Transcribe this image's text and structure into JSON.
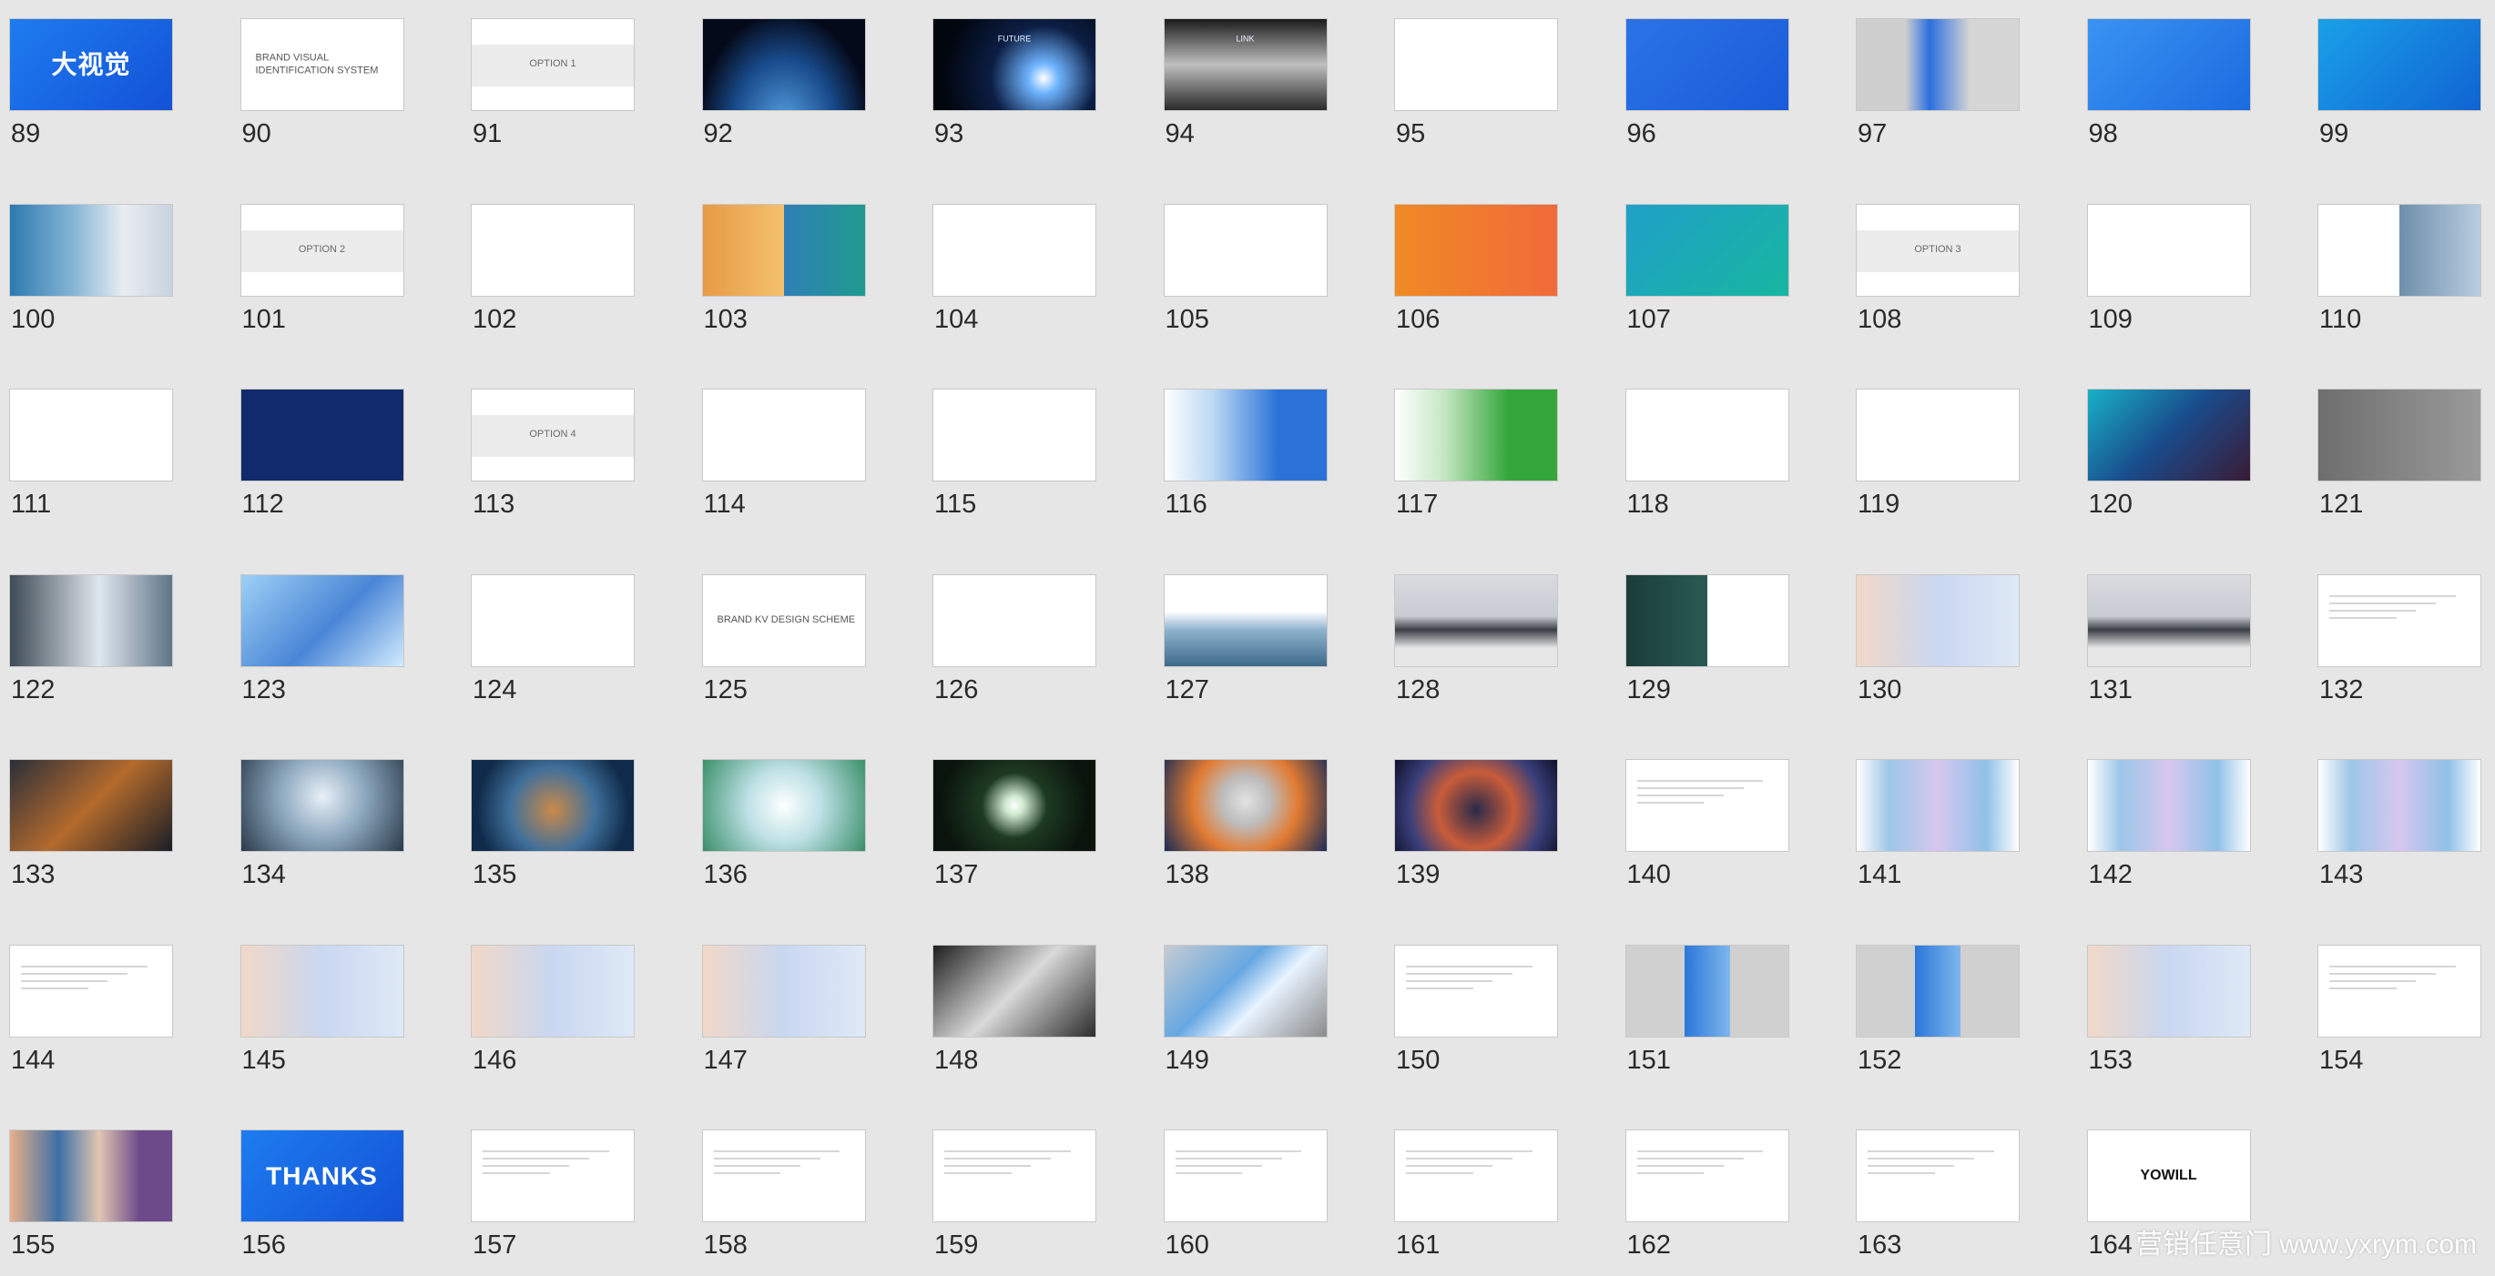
{
  "watermark": "营销任意门 www.yxrym.com",
  "colors": {
    "background": "#e6e6e6",
    "thumb_border": "#c8c8c8",
    "number_text": "#2a2a2a"
  },
  "slides": [
    {
      "number": "89",
      "text": "大视觉",
      "style": "blue-title"
    },
    {
      "number": "90",
      "text": "BRAND VISUAL IDENTIFICATION SYSTEM",
      "style": "white-left"
    },
    {
      "number": "91",
      "text": "OPTION 1",
      "style": "option"
    },
    {
      "number": "92",
      "text": "",
      "style": "earth"
    },
    {
      "number": "93",
      "text": "FUTURE",
      "style": "space-flare"
    },
    {
      "number": "94",
      "text": "LINK",
      "style": "train"
    },
    {
      "number": "95",
      "text": "",
      "style": "white"
    },
    {
      "number": "96",
      "text": "",
      "style": "blue"
    },
    {
      "number": "97",
      "text": "",
      "style": "gray-blue"
    },
    {
      "number": "98",
      "text": "",
      "style": "blue-cards"
    },
    {
      "number": "99",
      "text": "",
      "style": "blue-book"
    },
    {
      "number": "100",
      "text": "",
      "style": "books"
    },
    {
      "number": "101",
      "text": "OPTION 2",
      "style": "option"
    },
    {
      "number": "102",
      "text": "",
      "style": "white-logo"
    },
    {
      "number": "103",
      "text": "",
      "style": "sunset-split"
    },
    {
      "number": "104",
      "text": "",
      "style": "white-wave"
    },
    {
      "number": "105",
      "text": "",
      "style": "white-circles"
    },
    {
      "number": "106",
      "text": "",
      "style": "orange"
    },
    {
      "number": "107",
      "text": "",
      "style": "teal"
    },
    {
      "number": "108",
      "text": "OPTION 3",
      "style": "option"
    },
    {
      "number": "109",
      "text": "",
      "style": "white-logo"
    },
    {
      "number": "110",
      "text": "",
      "style": "white-photo"
    },
    {
      "number": "111",
      "text": "",
      "style": "white-logo"
    },
    {
      "number": "112",
      "text": "",
      "style": "navy"
    },
    {
      "number": "113",
      "text": "OPTION 4",
      "style": "option"
    },
    {
      "number": "114",
      "text": "",
      "style": "white-logo"
    },
    {
      "number": "115",
      "text": "",
      "style": "white-logo"
    },
    {
      "number": "116",
      "text": "",
      "style": "blue-fade"
    },
    {
      "number": "117",
      "text": "",
      "style": "green-fade"
    },
    {
      "number": "118",
      "text": "",
      "style": "white-icons"
    },
    {
      "number": "119",
      "text": "",
      "style": "white-icons-color"
    },
    {
      "number": "120",
      "text": "",
      "style": "gradient-dark"
    },
    {
      "number": "121",
      "text": "",
      "style": "gray-green"
    },
    {
      "number": "122",
      "text": "",
      "style": "stairs"
    },
    {
      "number": "123",
      "text": "",
      "style": "glass"
    },
    {
      "number": "124",
      "text": "",
      "style": "white-logo"
    },
    {
      "number": "125",
      "text": "BRAND KV DESIGN SCHEME",
      "style": "white-left"
    },
    {
      "number": "126",
      "text": "",
      "style": "white-calligraphy"
    },
    {
      "number": "127",
      "text": "",
      "style": "banner"
    },
    {
      "number": "128",
      "text": "",
      "style": "billboard"
    },
    {
      "number": "129",
      "text": "",
      "style": "posters"
    },
    {
      "number": "130",
      "text": "",
      "style": "pastel"
    },
    {
      "number": "131",
      "text": "",
      "style": "billboard"
    },
    {
      "number": "132",
      "text": "",
      "style": "white-lines"
    },
    {
      "number": "133",
      "text": "",
      "style": "city-night"
    },
    {
      "number": "134",
      "text": "",
      "style": "sky"
    },
    {
      "number": "135",
      "text": "",
      "style": "fisheye"
    },
    {
      "number": "136",
      "text": "",
      "style": "ring-green"
    },
    {
      "number": "137",
      "text": "",
      "style": "ring-dark"
    },
    {
      "number": "138",
      "text": "",
      "style": "circles-orange"
    },
    {
      "number": "139",
      "text": "",
      "style": "fisheye-night"
    },
    {
      "number": "140",
      "text": "",
      "style": "white-lines"
    },
    {
      "number": "141",
      "text": "",
      "style": "pastel-posters"
    },
    {
      "number": "142",
      "text": "",
      "style": "pastel-posters"
    },
    {
      "number": "143",
      "text": "",
      "style": "pastel-posters"
    },
    {
      "number": "144",
      "text": "",
      "style": "white-lines"
    },
    {
      "number": "145",
      "text": "",
      "style": "pastel"
    },
    {
      "number": "146",
      "text": "",
      "style": "pastel"
    },
    {
      "number": "147",
      "text": "",
      "style": "pastel"
    },
    {
      "number": "148",
      "text": "",
      "style": "tunnel"
    },
    {
      "number": "149",
      "text": "",
      "style": "tunnel-blue"
    },
    {
      "number": "150",
      "text": "",
      "style": "white-lines"
    },
    {
      "number": "151",
      "text": "",
      "style": "gray-poster"
    },
    {
      "number": "152",
      "text": "",
      "style": "gray-poster"
    },
    {
      "number": "153",
      "text": "",
      "style": "pastel"
    },
    {
      "number": "154",
      "text": "",
      "style": "white-lines"
    },
    {
      "number": "155",
      "text": "",
      "style": "posters-color"
    },
    {
      "number": "156",
      "text": "THANKS",
      "style": "blue-title"
    },
    {
      "number": "157",
      "text": "",
      "style": "white-lines"
    },
    {
      "number": "158",
      "text": "",
      "style": "white-lines"
    },
    {
      "number": "159",
      "text": "",
      "style": "white-lines"
    },
    {
      "number": "160",
      "text": "",
      "style": "white-lines"
    },
    {
      "number": "161",
      "text": "",
      "style": "white-lines"
    },
    {
      "number": "162",
      "text": "",
      "style": "white-lines"
    },
    {
      "number": "163",
      "text": "",
      "style": "white-lines"
    },
    {
      "number": "164",
      "text": "YOWILL",
      "style": "white-title"
    }
  ]
}
